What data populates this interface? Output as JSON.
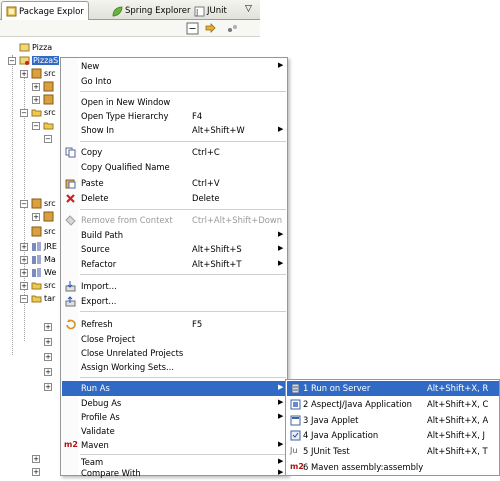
{
  "tabs": [
    {
      "label": "Package Explor",
      "icon": "package-explorer-icon",
      "active": true
    },
    {
      "label": "Spring Explorer",
      "icon": "spring-leaf-icon"
    },
    {
      "label": "JUnit",
      "icon": "junit-icon"
    }
  ],
  "tree": {
    "rows": [
      {
        "label": "Pizza",
        "icon": "project-icon"
      },
      {
        "label": "PizzaS",
        "icon": "project-icon",
        "selected": true
      },
      {
        "label": "src",
        "icon": "package-icon"
      },
      {
        "label": "src",
        "icon": "folder-icon"
      },
      {
        "label": "src",
        "icon": "package-icon"
      },
      {
        "label": "src",
        "icon": "package-icon"
      },
      {
        "label": "JRE",
        "icon": "library-icon"
      },
      {
        "label": "Ma",
        "icon": "library-icon"
      },
      {
        "label": "We",
        "icon": "library-icon"
      },
      {
        "label": "src",
        "icon": "folder-icon"
      },
      {
        "label": "tar",
        "icon": "folder-icon"
      }
    ]
  },
  "context_menu": {
    "items": [
      {
        "label": "New",
        "submenu": true
      },
      {
        "label": "Go Into"
      },
      {
        "label": "Open in New Window"
      },
      {
        "label": "Open Type Hierarchy",
        "accel": "F4"
      },
      {
        "label": "Show In",
        "accel": "Alt+Shift+W",
        "submenu": true
      },
      {
        "label": "Copy",
        "accel": "Ctrl+C",
        "icon": "copy-icon"
      },
      {
        "label": "Copy Qualified Name"
      },
      {
        "label": "Paste",
        "accel": "Ctrl+V",
        "icon": "paste-icon"
      },
      {
        "label": "Delete",
        "accel": "Delete",
        "icon": "delete-icon"
      },
      {
        "label": "Remove from Context",
        "accel": "Ctrl+Alt+Shift+Down",
        "disabled": true,
        "icon": "remove-context-icon"
      },
      {
        "label": "Build Path",
        "submenu": true
      },
      {
        "label": "Source",
        "accel": "Alt+Shift+S",
        "submenu": true
      },
      {
        "label": "Refactor",
        "accel": "Alt+Shift+T",
        "submenu": true
      },
      {
        "label": "Import...",
        "icon": "import-icon"
      },
      {
        "label": "Export...",
        "icon": "export-icon"
      },
      {
        "label": "Refresh",
        "accel": "F5",
        "icon": "refresh-icon"
      },
      {
        "label": "Close Project"
      },
      {
        "label": "Close Unrelated Projects"
      },
      {
        "label": "Assign Working Sets..."
      },
      {
        "label": "Run As",
        "submenu": true,
        "highlighted": true
      },
      {
        "label": "Debug As",
        "submenu": true
      },
      {
        "label": "Profile As",
        "submenu": true
      },
      {
        "label": "Validate"
      },
      {
        "label": "Maven",
        "submenu": true,
        "icon_text": "m2"
      },
      {
        "label": "Team",
        "submenu": true
      },
      {
        "label": "Compare With",
        "submenu": true
      }
    ]
  },
  "run_as_submenu": {
    "items": [
      {
        "label": "1 Run on Server",
        "accel": "Alt+Shift+X, R",
        "icon": "server-icon",
        "highlighted": true
      },
      {
        "label": "2 AspectJ/Java Application",
        "accel": "Alt+Shift+X, C",
        "icon": "aspectj-icon"
      },
      {
        "label": "3 Java Applet",
        "accel": "Alt+Shift+X, A",
        "icon": "java-applet-icon"
      },
      {
        "label": "4 Java Application",
        "accel": "Alt+Shift+X, J",
        "icon": "java-application-icon"
      },
      {
        "label": "5 JUnit Test",
        "accel": "Alt+Shift+X, T",
        "icon_text": "Ju"
      },
      {
        "label": "6 Maven assembly:assembly",
        "icon_text": "m2"
      }
    ]
  },
  "colors": {
    "selection": "#316ac5",
    "menu_border": "#979797"
  }
}
